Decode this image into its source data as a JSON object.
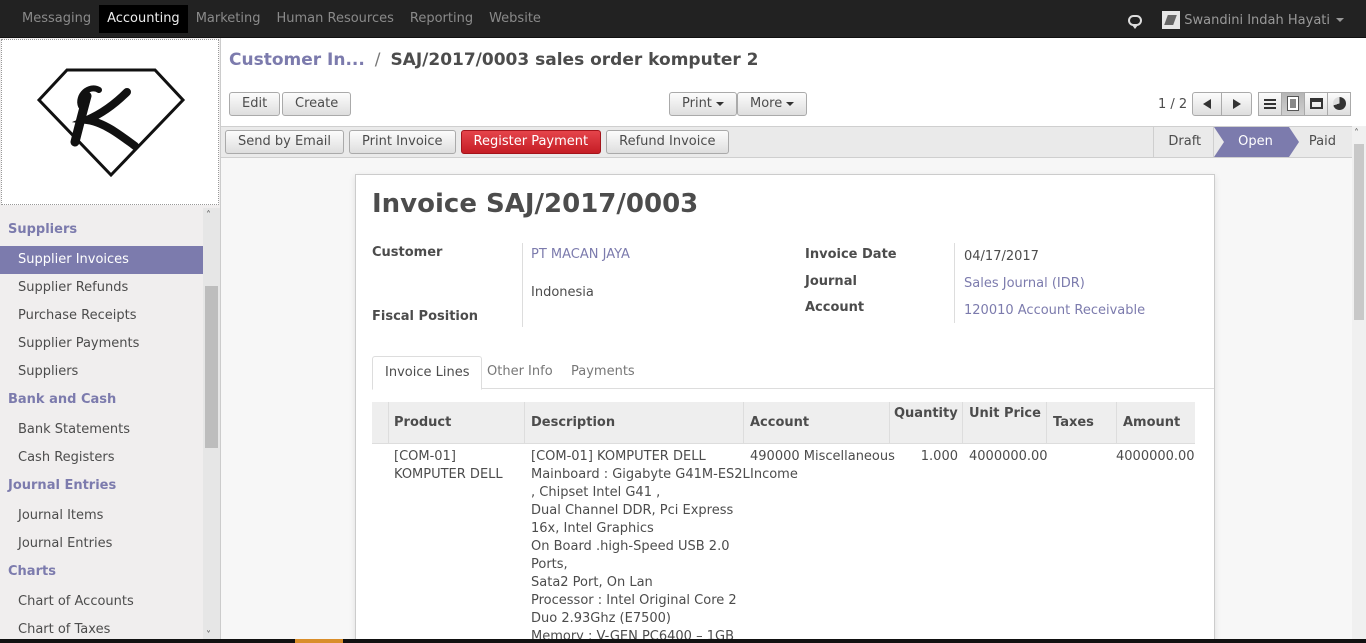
{
  "topbar": {
    "menu": [
      {
        "label": "Messaging",
        "active": false
      },
      {
        "label": "Accounting",
        "active": true
      },
      {
        "label": "Marketing",
        "active": false
      },
      {
        "label": "Human Resources",
        "active": false
      },
      {
        "label": "Reporting",
        "active": false
      },
      {
        "label": "Website",
        "active": false
      }
    ],
    "user_name": "Swandini Indah Hayati",
    "icons": {
      "chat": "chat-icon",
      "avatar": "user-avatar",
      "dropdown": "chevron-down-icon"
    }
  },
  "sidebar": {
    "sections": [
      {
        "title": "Suppliers",
        "items": [
          {
            "label": "Supplier Invoices",
            "active": true
          },
          {
            "label": "Supplier Refunds"
          },
          {
            "label": "Purchase Receipts"
          },
          {
            "label": "Supplier Payments"
          },
          {
            "label": "Suppliers"
          }
        ]
      },
      {
        "title": "Bank and Cash",
        "items": [
          {
            "label": "Bank Statements"
          },
          {
            "label": "Cash Registers"
          }
        ]
      },
      {
        "title": "Journal Entries",
        "items": [
          {
            "label": "Journal Items"
          },
          {
            "label": "Journal Entries"
          }
        ]
      },
      {
        "title": "Charts",
        "items": [
          {
            "label": "Chart of Accounts"
          },
          {
            "label": "Chart of Taxes"
          }
        ]
      }
    ]
  },
  "breadcrumb": {
    "parent": "Customer In...",
    "separator": "/",
    "current": "SAJ/2017/0003 sales order komputer 2"
  },
  "toolbar": {
    "edit": "Edit",
    "create": "Create",
    "print": "Print",
    "more": "More",
    "pager": "1 / 2"
  },
  "statusbar": {
    "send_email": "Send by Email",
    "print_invoice": "Print Invoice",
    "register_payment": "Register Payment",
    "refund_invoice": "Refund Invoice",
    "states": [
      "Draft",
      "Open",
      "Paid"
    ],
    "current_state": "Open"
  },
  "invoice": {
    "title": "Invoice SAJ/2017/0003",
    "customer_label": "Customer",
    "customer": "PT MACAN JAYA",
    "customer_country": "Indonesia",
    "fiscal_position_label": "Fiscal Position",
    "invoice_date_label": "Invoice Date",
    "invoice_date": "04/17/2017",
    "journal_label": "Journal",
    "journal": "Sales Journal (IDR)",
    "account_label": "Account",
    "account": "120010 Account Receivable"
  },
  "tabs": [
    "Invoice Lines",
    "Other Info",
    "Payments"
  ],
  "lines": {
    "headers": [
      "Product",
      "Description",
      "Account",
      "Quantity",
      "Unit Price",
      "Taxes",
      "Amount"
    ],
    "rows": [
      {
        "product": [
          "[COM-01]",
          "KOMPUTER DELL"
        ],
        "description": [
          "[COM-01] KOMPUTER DELL",
          "Mainboard : Gigabyte G41M-ES2L",
          ", Chipset Intel G41 ,",
          "Dual Channel DDR, Pci Express",
          "16x, Intel Graphics",
          "On Board .high-Speed USB 2.0",
          "Ports,",
          "Sata2 Port, On Lan",
          "Processor : Intel Original Core 2",
          "Duo 2.93Ghz (E7500)",
          "Memory : V-GEN PC6400 – 1GB"
        ],
        "account": [
          "490000 Miscellaneous",
          "Income"
        ],
        "quantity": "1.000",
        "unit_price": "4000000.00",
        "taxes": "",
        "amount": "4000000.00"
      }
    ]
  }
}
